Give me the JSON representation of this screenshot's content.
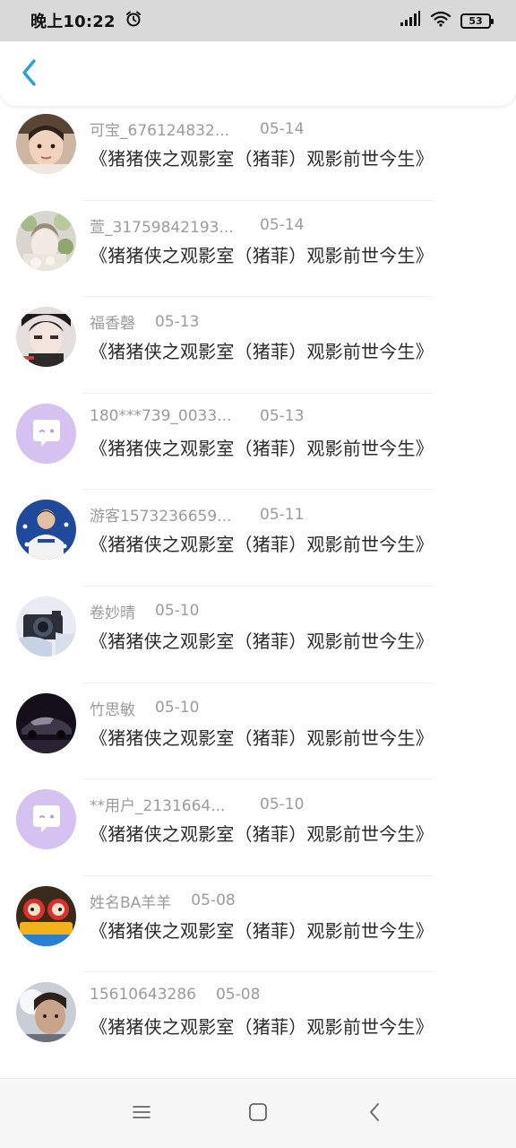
{
  "status_bar": {
    "time": "晚上10:22",
    "battery": "53"
  },
  "header": {
    "back_icon": "chevron-left-icon",
    "accent_color": "#2a9fd8"
  },
  "items": [
    {
      "name": "可宝_676124832...",
      "date": "05-14",
      "title": "《猪猪侠之观影室（猪菲）观影前世今生》",
      "avatar": "photo-boy"
    },
    {
      "name": "萱_31759842193...",
      "date": "05-14",
      "title": "《猪猪侠之观影室（猪菲）观影前世今生》",
      "avatar": "photo-flowers"
    },
    {
      "name": "福香磬",
      "date": "05-13",
      "title": "《猪猪侠之观影室（猪菲）观影前世今生》",
      "avatar": "photo-face"
    },
    {
      "name": "180***739_0033...",
      "date": "05-13",
      "title": "《猪猪侠之观影室（猪菲）观影前世今生》",
      "avatar": "default-chat-avatar"
    },
    {
      "name": "游客1573236659...",
      "date": "05-11",
      "title": "《猪猪侠之观影室（猪菲）观影前世今生》",
      "avatar": "photo-stars"
    },
    {
      "name": "卷妙晴",
      "date": "05-10",
      "title": "《猪猪侠之观影室（猪菲）观影前世今生》",
      "avatar": "photo-camera"
    },
    {
      "name": "竹思敏",
      "date": "05-10",
      "title": "《猪猪侠之观影室（猪菲）观影前世今生》",
      "avatar": "photo-car"
    },
    {
      "name": "**用户_2131664...",
      "date": "05-10",
      "title": "《猪猪侠之观影室（猪菲）观影前世今生》",
      "avatar": "default-chat-avatar"
    },
    {
      "name": "姓名BA羊羊",
      "date": "05-08",
      "title": "《猪猪侠之观影室（猪菲）观影前世今生》",
      "avatar": "photo-cartoon"
    },
    {
      "name": "15610643286",
      "date": "05-08",
      "title": "《猪猪侠之观影室（猪菲）观影前世今生》",
      "avatar": "photo-selfie"
    }
  ],
  "nav_bar": {
    "menu_icon": "menu-icon",
    "home_icon": "home-square-icon",
    "back_icon": "back-triangle-icon"
  }
}
